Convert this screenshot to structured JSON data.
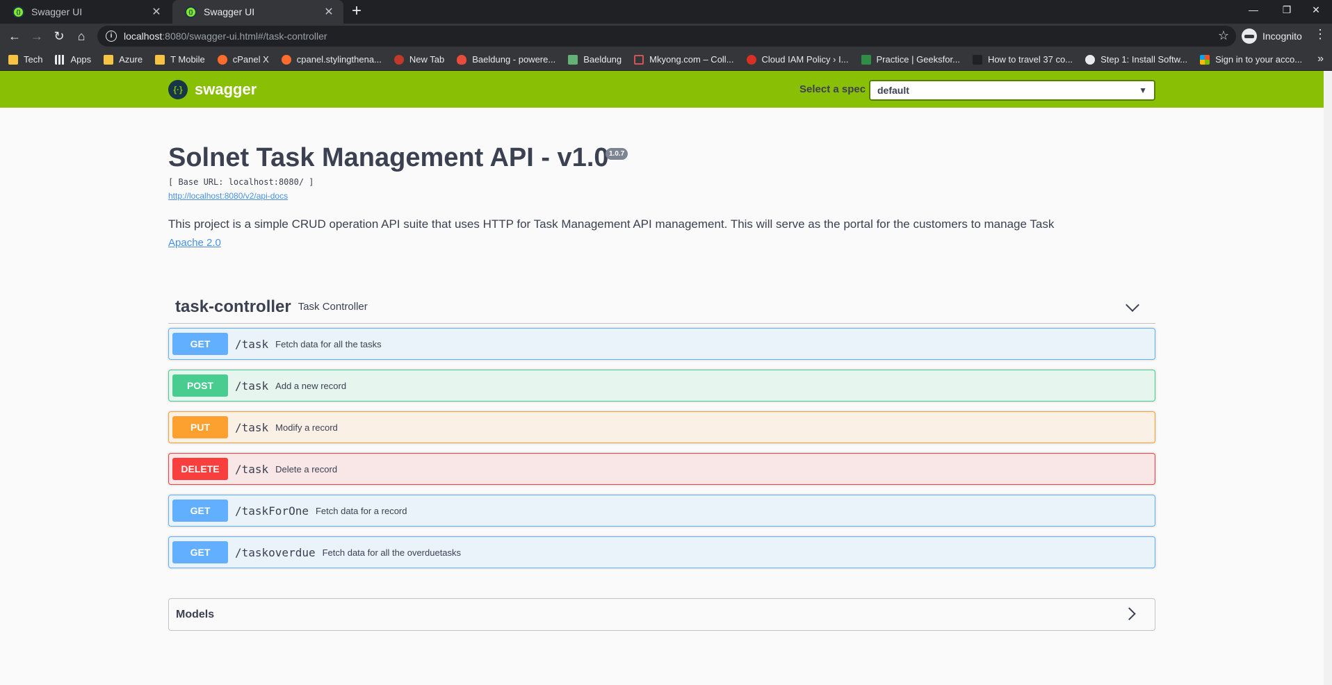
{
  "browser": {
    "tabs": [
      {
        "title": "Swagger UI",
        "active": false
      },
      {
        "title": "Swagger UI",
        "active": true
      }
    ],
    "new_tab": "+",
    "controls": {
      "minimize": "—",
      "restore": "❐",
      "close": "✕"
    },
    "url_host": "localhost",
    "url_rest": ":8080/swagger-ui.html#/task-controller",
    "incognito_label": "Incognito",
    "bookmarks": [
      {
        "label": "Tech",
        "icon": "folder-icon"
      },
      {
        "label": "Apps",
        "icon": "apps-icon"
      },
      {
        "label": "Azure",
        "icon": "folder-icon"
      },
      {
        "label": "T Mobile",
        "icon": "folder-icon"
      },
      {
        "label": "cPanel X",
        "icon": "cpanel-icon"
      },
      {
        "label": "cpanel.stylingthena...",
        "icon": "cpanel-icon"
      },
      {
        "label": "New Tab",
        "icon": "dev-icon"
      },
      {
        "label": "Baeldung - powere...",
        "icon": "fire-icon"
      },
      {
        "label": "Baeldung",
        "icon": "leaf-icon"
      },
      {
        "label": "Mkyong.com – Coll...",
        "icon": "mkyong-icon"
      },
      {
        "label": "Cloud IAM Policy › I...",
        "icon": "gcp-icon"
      },
      {
        "label": "Practice | Geeksfor...",
        "icon": "gfg-icon"
      },
      {
        "label": "How to travel 37 co...",
        "icon": "dark-icon"
      },
      {
        "label": "Step 1: Install Softw...",
        "icon": "globe-icon"
      },
      {
        "label": "Sign in to your acco...",
        "icon": "microsoft-icon"
      }
    ]
  },
  "swagger": {
    "logo_text": "swagger",
    "spec_label": "Select a spec",
    "spec_value": "default",
    "title": "Solnet Task Management API - v1.0",
    "version": "1.0.7",
    "base_url": "[ Base URL: localhost:8080/ ]",
    "api_docs_link": "http://localhost:8080/v2/api-docs",
    "description": "This project is a simple CRUD operation API suite that uses HTTP for Task Management API management. This will serve as the portal for the customers to manage Task",
    "license": "Apache 2.0",
    "tag": {
      "name": "task-controller",
      "description": "Task Controller"
    },
    "operations": [
      {
        "method": "GET",
        "path": "/task",
        "summary": "Fetch data for all the tasks"
      },
      {
        "method": "POST",
        "path": "/task",
        "summary": "Add a new record"
      },
      {
        "method": "PUT",
        "path": "/task",
        "summary": "Modify a record"
      },
      {
        "method": "DELETE",
        "path": "/task",
        "summary": "Delete a record"
      },
      {
        "method": "GET",
        "path": "/taskForOne",
        "summary": "Fetch data for a record"
      },
      {
        "method": "GET",
        "path": "/taskoverdue",
        "summary": "Fetch data for all the overduetasks"
      }
    ],
    "models_title": "Models",
    "colors": {
      "topbar": "#89bf04",
      "get": "#61affe",
      "post": "#49cc90",
      "put": "#fca130",
      "delete": "#f93e3e"
    }
  }
}
